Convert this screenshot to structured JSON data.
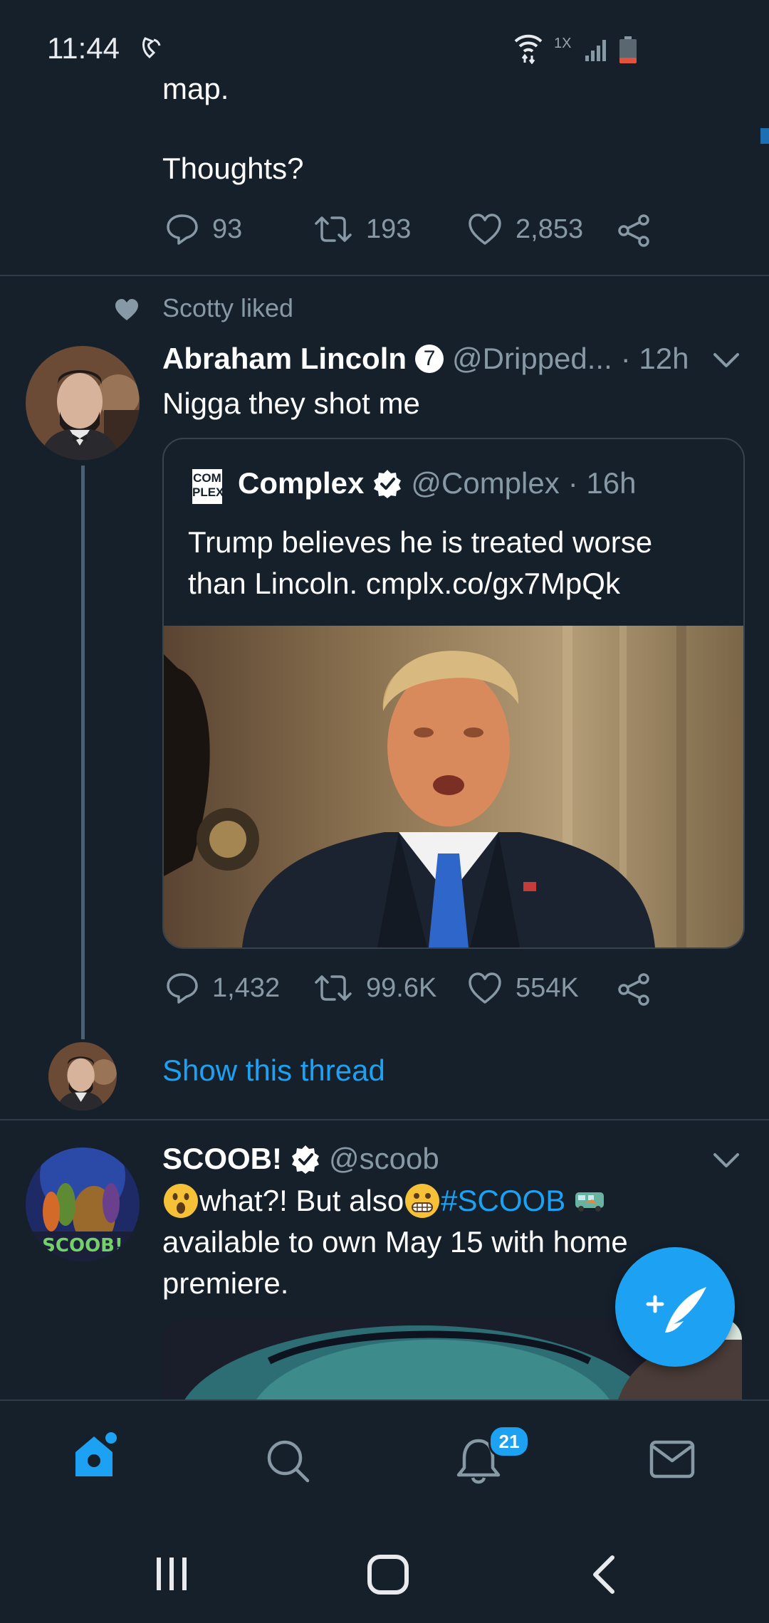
{
  "status_bar": {
    "time": "11:44",
    "network": "1X"
  },
  "prev_tweet": {
    "text_fragment": "map.",
    "text_last": "Thoughts?",
    "replies": "93",
    "retweets": "193",
    "likes": "2,853"
  },
  "tweet1": {
    "social_context": "Scotty liked",
    "name": "Abraham Lincoln",
    "badge_number": "7",
    "handle": "@Dripped...",
    "time": "· 12h",
    "text": "Nigga they shot me",
    "quote": {
      "logo_text": "COM PLEX",
      "name": "Complex",
      "handle": "@Complex",
      "time": "· 16h",
      "text": "Trump believes he is treated worse than Lincoln. cmplx.co/gx7MpQk"
    },
    "replies": "1,432",
    "retweets": "99.6K",
    "likes": "554K",
    "show_thread": "Show this thread"
  },
  "tweet2": {
    "name": "SCOOB!",
    "handle": "@scoob",
    "text_part1": "what?! But also",
    "hashtag": "#SCOOB",
    "text_part2": "available to own May 15 with home",
    "text_part3": "premiere.",
    "avatar_text": "SCOOB!"
  },
  "bottom_nav": {
    "notifications_badge": "21"
  },
  "colors": {
    "background": "#15202b",
    "accent": "#1da1f2",
    "muted": "#8899a6",
    "divider": "#2f3d4b"
  },
  "icons": [
    "wifi-calling-icon",
    "wifi-icon",
    "signal-icon",
    "battery-icon",
    "reply-icon",
    "retweet-icon",
    "like-icon",
    "share-icon",
    "heart-icon",
    "verified-icon",
    "chevron-down-icon",
    "compose-icon",
    "home-icon",
    "search-icon",
    "notifications-icon",
    "messages-icon",
    "recents-icon",
    "home-button-icon",
    "back-icon"
  ]
}
